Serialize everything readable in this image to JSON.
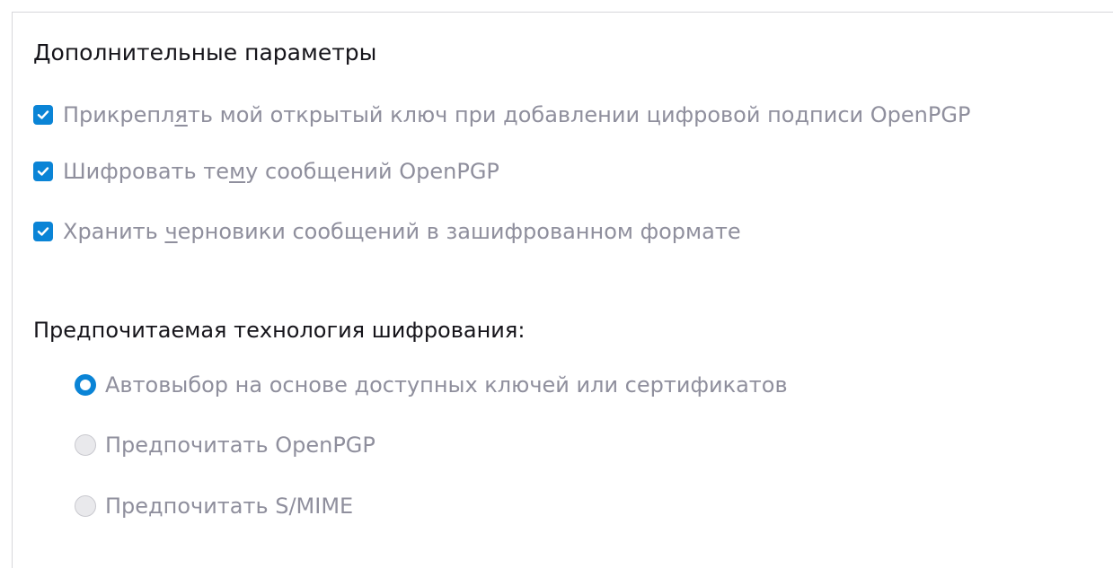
{
  "section": {
    "title": "Дополнительные параметры"
  },
  "checkboxes": [
    {
      "label_pre": "Прикрепл",
      "label_accel": "я",
      "label_post": "ть мой открытый ключ при добавлении цифровой подписи OpenPGP",
      "checked": true
    },
    {
      "label_pre": "Шифровать те",
      "label_accel": "м",
      "label_post": "у сообщений OpenPGP",
      "checked": true
    },
    {
      "label_pre": "Хранить ",
      "label_accel": "ч",
      "label_post": "ерновики сообщений в зашифрованном формате",
      "checked": true
    }
  ],
  "encryption_preference": {
    "heading": "Предпочитаемая технология шифрования:",
    "options": [
      {
        "label": "Автовыбор на основе доступных ключей или сертификатов",
        "selected": true
      },
      {
        "label": "Предпочитать OpenPGP",
        "selected": false
      },
      {
        "label": "Предпочитать S/MIME",
        "selected": false
      }
    ]
  },
  "colors": {
    "accent": "#0a84d6",
    "title_text": "#15141a",
    "disabled_text": "#8f8f9d"
  }
}
